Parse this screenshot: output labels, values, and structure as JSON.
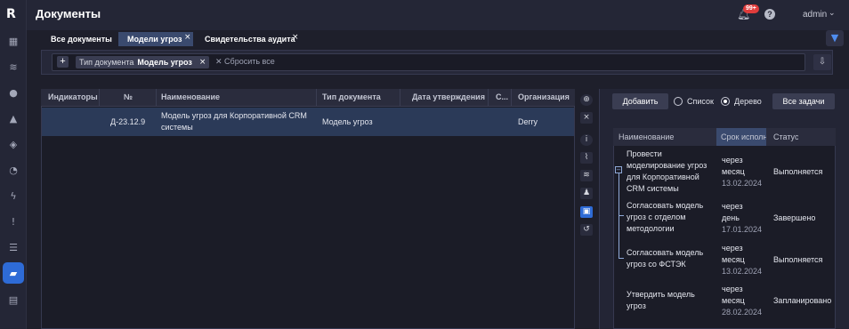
{
  "app": {
    "logo": "R",
    "title": "Документы"
  },
  "header": {
    "notifications_badge": "99+",
    "user": "admin"
  },
  "sidebar": {
    "items": [
      {
        "icon": "grid-icon"
      },
      {
        "icon": "database-icon"
      },
      {
        "icon": "drop-icon"
      },
      {
        "icon": "warning-icon"
      },
      {
        "icon": "shield-icon"
      },
      {
        "icon": "pie-icon"
      },
      {
        "icon": "lightning-icon"
      },
      {
        "icon": "alert-circle-icon"
      },
      {
        "icon": "list-icon"
      },
      {
        "icon": "folder-open-icon",
        "active": true
      },
      {
        "icon": "document-icon"
      }
    ]
  },
  "tabs": [
    {
      "label": "Все документы",
      "active": false
    },
    {
      "label": "Модели угроз",
      "active": true
    },
    {
      "label": "Свидетельства аудита",
      "active": false
    }
  ],
  "filters": {
    "chip_name": "Тип документа",
    "chip_value": "Модель угроз",
    "reset": "Сбросить все"
  },
  "grid": {
    "columns": [
      "Индикаторы",
      "№",
      "Наименование",
      "Тип документа",
      "Дата утверждения",
      "С...",
      "Организация"
    ],
    "rows": [
      {
        "indicators": "",
        "number": "Д-23.12.9",
        "name_line1": "Модель угроз для Корпоративной CRM",
        "name_line2": "системы",
        "type": "Модель угроз",
        "date": "",
        "s": "",
        "org": "Derry"
      }
    ]
  },
  "right_panel": {
    "add_button": "Добавить",
    "view_list": "Список",
    "view_tree": "Дерево",
    "selected_view": "Дерево",
    "all_tasks_button": "Все задачи",
    "columns": [
      "Наименование",
      "Срок исполнения",
      "Статус"
    ],
    "tasks": [
      {
        "name": [
          "Провести",
          "моделирование угроз",
          "для Корпоративной",
          "CRM системы"
        ],
        "due": [
          "через",
          "месяц"
        ],
        "date": "13.02.2024",
        "status": "Выполняется"
      },
      {
        "name": [
          "Согласовать модель",
          "угроз с отделом",
          "методологии"
        ],
        "due": [
          "через",
          "день"
        ],
        "date": "17.01.2024",
        "status": "Завершено"
      },
      {
        "name": [
          "Согласовать модель",
          "угроз со ФСТЭК"
        ],
        "due": [
          "через",
          "месяц"
        ],
        "date": "13.02.2024",
        "status": "Выполняется"
      },
      {
        "name": [
          "Утвердить модель",
          "угроз"
        ],
        "due": [
          "через",
          "месяц"
        ],
        "date": "28.02.2024",
        "status": "Запланировано"
      }
    ]
  },
  "colors": {
    "accent": "#2e6bd6",
    "selected_row": "#2b3a58",
    "badge": "#e03c3c"
  }
}
